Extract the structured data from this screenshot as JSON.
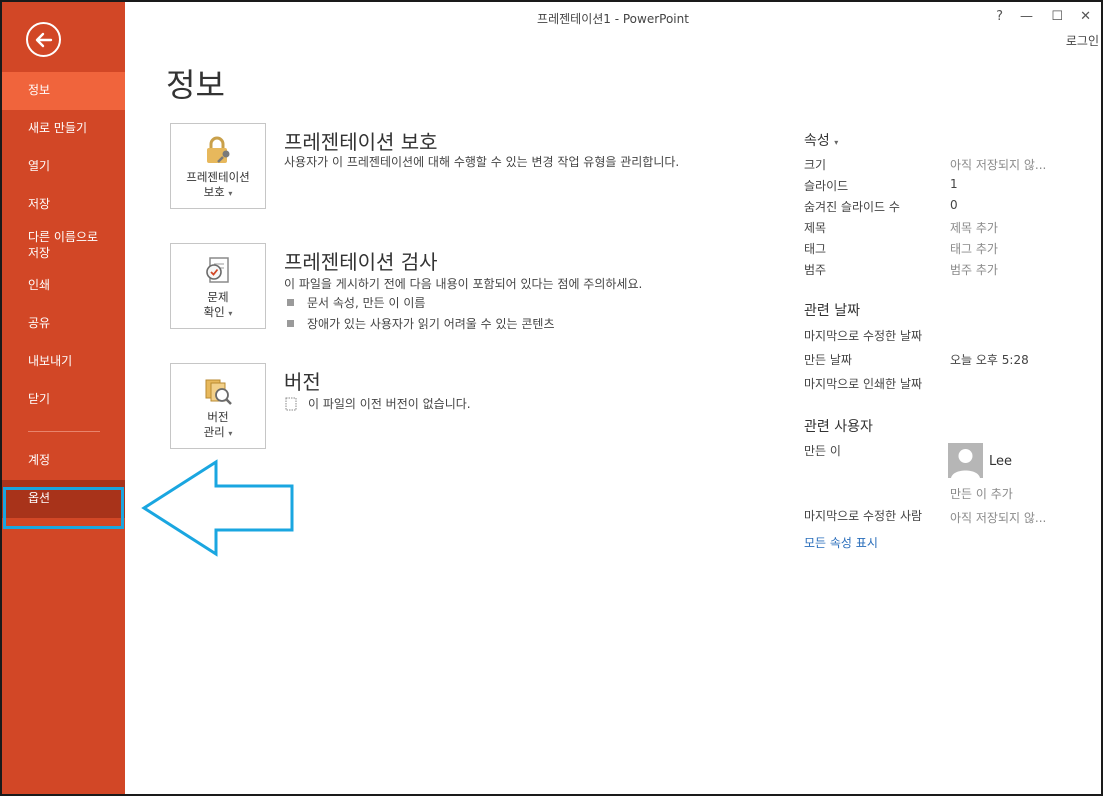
{
  "window": {
    "title": "프레젠테이션1 - PowerPoint",
    "help": "?",
    "minimize": "—",
    "maximize": "☐",
    "close": "✕",
    "login": "로그인"
  },
  "sidebar": {
    "items": [
      {
        "label": "정보"
      },
      {
        "label": "새로 만들기"
      },
      {
        "label": "열기"
      },
      {
        "label": "저장"
      },
      {
        "label": "다른 이름으로\n저장"
      },
      {
        "label": "인쇄"
      },
      {
        "label": "공유"
      },
      {
        "label": "내보내기"
      },
      {
        "label": "닫기"
      },
      {
        "label": "계정"
      },
      {
        "label": "옵션"
      }
    ],
    "colors": {
      "bg": "#d24726",
      "active": "#f0643c",
      "highlight": "#1aa6e0"
    }
  },
  "main": {
    "page_title": "정보",
    "protect": {
      "card_label_1": "프레젠테이션",
      "card_label_2": "보호",
      "title": "프레젠테이션 보호",
      "desc": "사용자가 이 프레젠테이션에 대해 수행할 수 있는 변경 작업 유형을 관리합니다."
    },
    "inspect": {
      "card_label_1": "문제",
      "card_label_2": "확인",
      "title": "프레젠테이션 검사",
      "desc": "이 파일을 게시하기 전에 다음 내용이 포함되어 있다는 점에 주의하세요.",
      "bullets": [
        "문서 속성, 만든 이 이름",
        "장애가 있는 사용자가 읽기 어려울 수 있는 콘텐츠"
      ]
    },
    "versions": {
      "card_label_1": "버전",
      "card_label_2": "관리",
      "title": "버전",
      "desc": "이 파일의 이전 버전이 없습니다."
    }
  },
  "properties": {
    "header": "속성",
    "rows": [
      {
        "label": "크기",
        "value": "아직 저장되지 않..."
      },
      {
        "label": "슬라이드",
        "value": "1"
      },
      {
        "label": "숨겨진 슬라이드 수",
        "value": "0"
      },
      {
        "label": "제목",
        "value": "제목 추가"
      },
      {
        "label": "태그",
        "value": "태그 추가"
      },
      {
        "label": "범주",
        "value": "범주 추가"
      }
    ],
    "dates_header": "관련 날짜",
    "dates": [
      {
        "label": "마지막으로 수정한 날짜",
        "value": ""
      },
      {
        "label": "만든 날짜",
        "value": "오늘 오후 5:28"
      },
      {
        "label": "마지막으로 인쇄한 날짜",
        "value": ""
      }
    ],
    "people_header": "관련 사용자",
    "author_label": "만든 이",
    "author_name": "Lee",
    "add_author": "만든 이 추가",
    "last_modified_by_label": "마지막으로 수정한 사람",
    "last_modified_by_value": "아직 저장되지 않...",
    "show_all": "모든 속성 표시"
  }
}
